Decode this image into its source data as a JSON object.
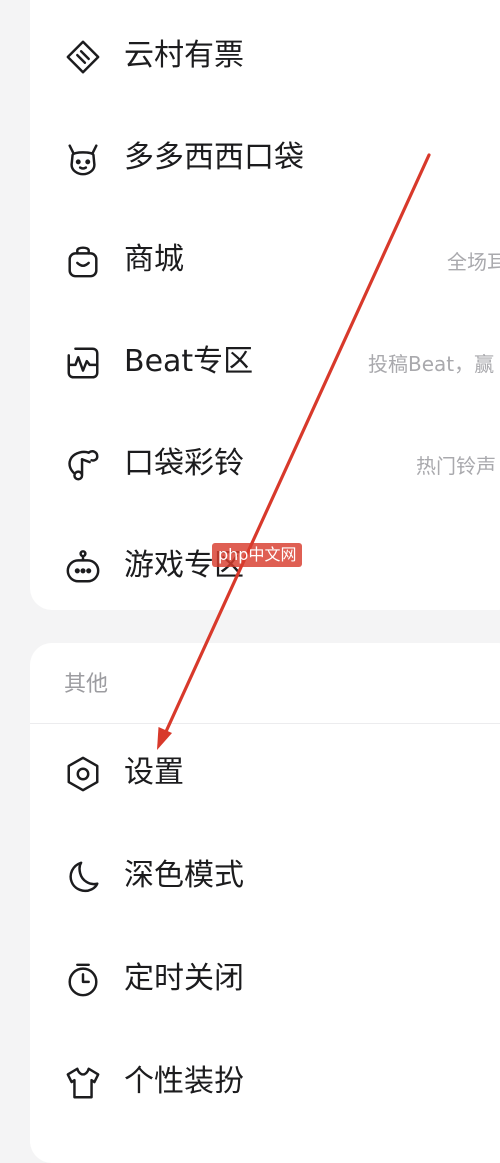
{
  "menu_top": {
    "items": [
      {
        "label": "云村有票",
        "icon": "ticket-icon",
        "subtitle": ""
      },
      {
        "label": "多多西西口袋",
        "icon": "deer-head-icon",
        "subtitle": ""
      },
      {
        "label": "商城",
        "icon": "shopping-bag-icon",
        "subtitle": "全场耳"
      },
      {
        "label": "Beat专区",
        "icon": "beat-wave-icon",
        "subtitle": "投稿Beat，赢"
      },
      {
        "label": "口袋彩铃",
        "icon": "music-note-icon",
        "subtitle": "热门铃声"
      },
      {
        "label": "游戏专区",
        "icon": "gamepad-icon",
        "subtitle": ""
      }
    ]
  },
  "menu_other": {
    "section_title": "其他",
    "items": [
      {
        "label": "设置",
        "icon": "settings-hexagon-icon"
      },
      {
        "label": "深色模式",
        "icon": "moon-icon"
      },
      {
        "label": "定时关闭",
        "icon": "timer-icon"
      },
      {
        "label": "个性装扮",
        "icon": "tshirt-icon"
      }
    ]
  },
  "watermark": {
    "text": "php中文网"
  },
  "colors": {
    "background": "#f4f4f5",
    "card": "#ffffff",
    "text": "#1c1c1e",
    "subtext": "#a9a9ad",
    "annotation_arrow": "#d8392b"
  }
}
